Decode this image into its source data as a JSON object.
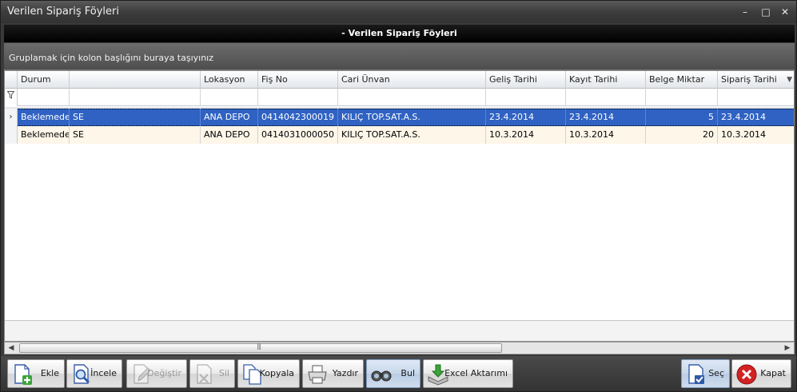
{
  "window": {
    "title": "Verilen Sipariş Föyleri",
    "controls": {
      "minimize": "–",
      "maximize": "□",
      "close": "✕"
    }
  },
  "header": {
    "title": "- Verilen Sipariş Föyleri"
  },
  "group_panel": {
    "hint": "Gruplamak için kolon başlığını buraya taşıyınız"
  },
  "grid": {
    "columns": [
      "Durum",
      "",
      "Lokasyon",
      "Fiş No",
      "Cari Ünvan",
      "Geliş Tarihi",
      "Kayıt Tarihi",
      "Belge Miktar",
      "Sipariş Tarihi"
    ],
    "sort_indicator": "▼",
    "filter_icon": "funnel-icon",
    "current_row_marker": "›",
    "rows": [
      [
        "Beklemede",
        "SE",
        "ANA DEPO",
        "0414042300019",
        "KILIÇ TOP.SAT.A.S.",
        "23.4.2014",
        "23.4.2014",
        "5",
        "23.4.2014"
      ],
      [
        "Beklemede",
        "SE",
        "ANA DEPO",
        "0414031000050",
        "KILIÇ TOP.SAT.A.S.",
        "10.3.2014",
        "10.3.2014",
        "20",
        "10.3.2014"
      ]
    ],
    "selected_row": 0
  },
  "scrollbar": {
    "left_arrow": "◀",
    "right_arrow": "▶"
  },
  "toolbar": {
    "ekle": "Ekle",
    "incele": "İncele",
    "degistir": "Değiştir",
    "sil": "Sil",
    "kopyala": "Kopyala",
    "yazdir": "Yazdır",
    "bul": "Bul",
    "excel": "Excel Aktarımı",
    "sec": "Seç",
    "kapat": "Kapat"
  },
  "colors": {
    "selection": "#2f62c3",
    "alt_row": "#fdf6e9",
    "add_green": "#3aa33a",
    "close_red": "#d22222"
  }
}
